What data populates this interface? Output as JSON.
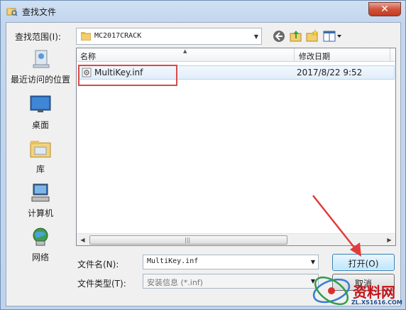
{
  "window": {
    "title": "查找文件",
    "close_glyph": "✕"
  },
  "toolbar": {
    "look_in_label": "查找范围(I):",
    "look_in_value": "MC2017CRACK",
    "icons": [
      "back-arrow-icon",
      "up-folder-icon",
      "new-folder-icon",
      "view-menu-icon"
    ]
  },
  "places": [
    {
      "label": "最近访问的位置",
      "icon": "recent-places-icon"
    },
    {
      "label": "桌面",
      "icon": "desktop-icon"
    },
    {
      "label": "库",
      "icon": "libraries-icon"
    },
    {
      "label": "计算机",
      "icon": "computer-icon"
    },
    {
      "label": "网络",
      "icon": "network-icon"
    }
  ],
  "file_list": {
    "columns": [
      "名称",
      "修改日期"
    ],
    "rows": [
      {
        "name": "MultiKey.inf",
        "date": "2017/8/22 9:52",
        "icon": "inf-file-icon"
      }
    ],
    "scroll_grip": "|||"
  },
  "form": {
    "filename_label": "文件名(N):",
    "filename_value": "MultiKey.inf",
    "filetype_label": "文件类型(T):",
    "filetype_value": "安装信息 (*.inf)"
  },
  "buttons": {
    "open": "打开(O)",
    "cancel": "取消"
  },
  "watermark": {
    "text": "资料网",
    "url": "ZL.XS1616.COM"
  },
  "colors": {
    "highlight_red": "#d44b4b",
    "selection_blue": "#e2eefb",
    "accent_blue": "#3c7fb1"
  }
}
